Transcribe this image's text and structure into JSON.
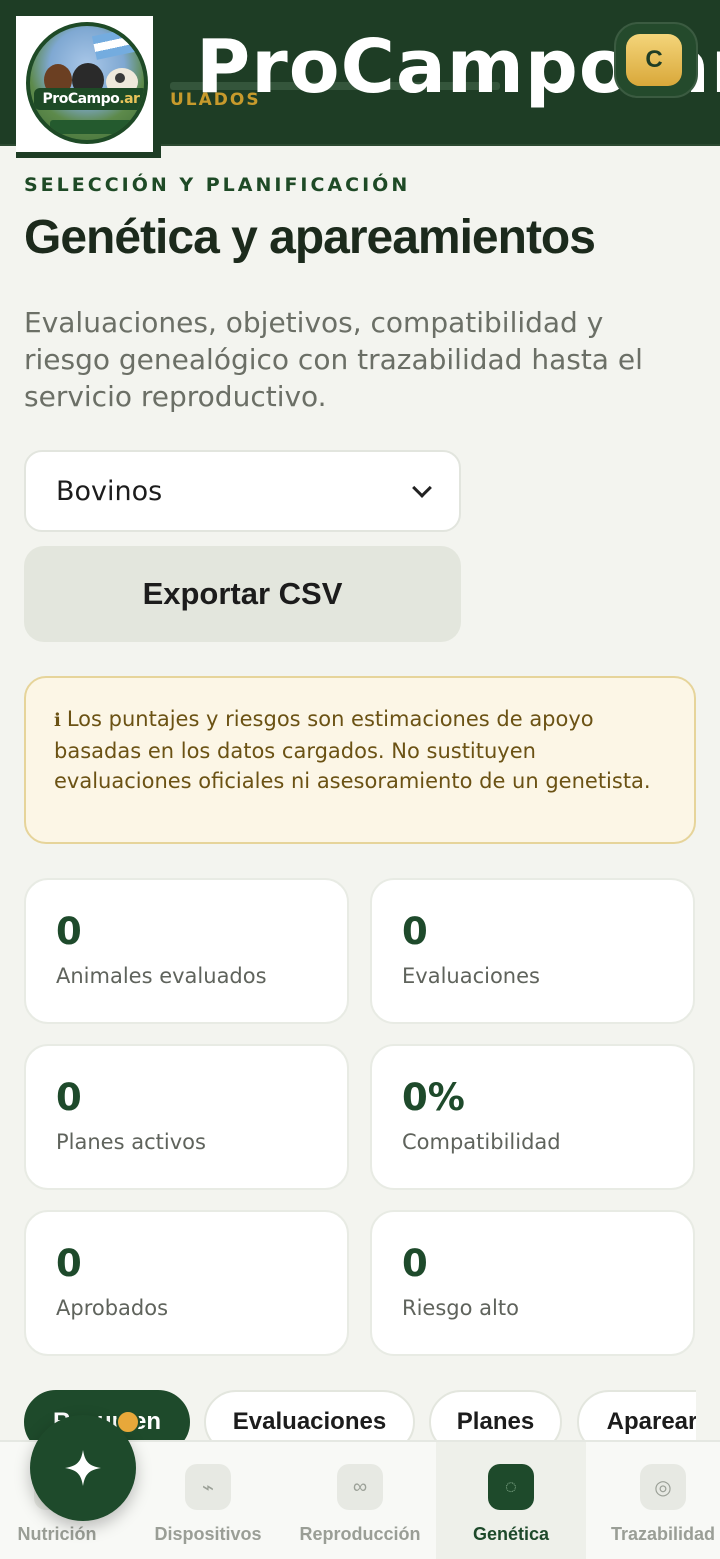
{
  "header": {
    "brand_title": "ProCampo.ar",
    "subtitle": "ULADOS",
    "user_initial": "C",
    "logo": {
      "name": "ProCampo",
      "suffix": ".ar"
    }
  },
  "page": {
    "eyebrow": "SELECCIÓN Y PLANIFICACIÓN",
    "title": "Genética y apareamientos",
    "description": "Evaluaciones, objetivos, compatibilidad y riesgo genealógico con trazabilidad hasta el servicio reproductivo."
  },
  "controls": {
    "species_selected": "Bovinos",
    "export_label": "Exportar CSV"
  },
  "notice": {
    "icon": "ℹ",
    "text": "Los puntajes y riesgos son estimaciones de apoyo basadas en los datos cargados. No sustituyen evaluaciones oficiales ni asesoramiento de un genetista."
  },
  "stats": [
    {
      "value": "0",
      "label": "Animales evaluados"
    },
    {
      "value": "0",
      "label": "Evaluaciones"
    },
    {
      "value": "0",
      "label": "Planes activos"
    },
    {
      "value": "0%",
      "label": "Compatibilidad"
    },
    {
      "value": "0",
      "label": "Aprobados"
    },
    {
      "value": "0",
      "label": "Riesgo alto"
    }
  ],
  "tabs": [
    {
      "label": "Resumen"
    },
    {
      "label": "Evaluaciones"
    },
    {
      "label": "Planes"
    },
    {
      "label": "Aparear"
    }
  ],
  "bottom_nav": [
    {
      "label": "Nutrición",
      "icon": "nutrition-icon"
    },
    {
      "label": "Dispositivos",
      "icon": "devices-icon",
      "glyph": "⌁"
    },
    {
      "label": "Reproducción",
      "icon": "reproduction-icon",
      "glyph": "∞"
    },
    {
      "label": "Genética",
      "icon": "genetics-icon",
      "glyph": "◌"
    },
    {
      "label": "Trazabilidad",
      "icon": "traceability-icon",
      "glyph": "◎"
    }
  ],
  "colors": {
    "brand_green": "#1e3d25",
    "accent_gold": "#c79a2c",
    "notice_bg": "#fcf6e6",
    "active_tab": "#1e4a2b"
  }
}
